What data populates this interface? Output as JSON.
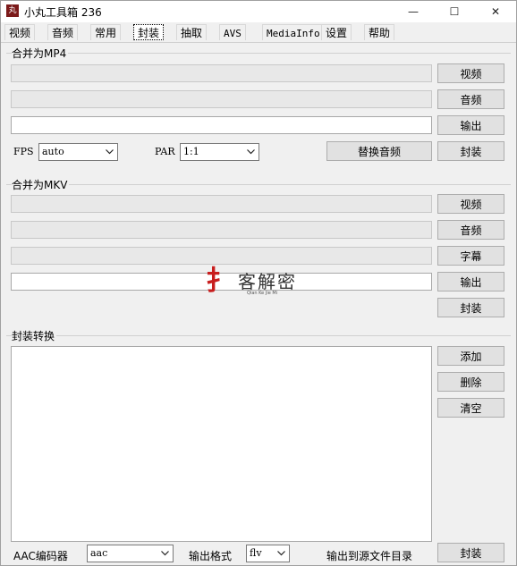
{
  "window": {
    "title": "小丸工具箱 236",
    "icon_glyph": "丸",
    "minimize_glyph": "—",
    "maximize_glyph": "☐",
    "close_glyph": "✕"
  },
  "tabs": [
    "视频",
    "音频",
    "常用",
    "封装",
    "抽取",
    "AVS",
    "MediaInfo",
    "设置",
    "帮助"
  ],
  "active_tab": "封装",
  "mp4": {
    "group_label": "合并为MP4",
    "video_button": "视频",
    "audio_button": "音频",
    "output_button": "输出",
    "fps_label": "FPS",
    "fps_value": "auto",
    "par_label": "PAR",
    "par_value": "1:1",
    "replace_audio_button": "替换音频",
    "mux_button": "封装"
  },
  "mkv": {
    "group_label": "合并为MKV",
    "video_button": "视频",
    "audio_button": "音频",
    "subtitle_button": "字幕",
    "output_button": "输出",
    "mux_button": "封装"
  },
  "convert": {
    "group_label": "封装转换",
    "add_button": "添加",
    "delete_button": "删除",
    "clear_button": "清空",
    "aac_label": "AAC编码器",
    "aac_value": "aac",
    "format_label": "输出格式",
    "format_value": "flv",
    "output_to_source_label": "输出到源文件目录",
    "mux_button": "封装"
  },
  "watermark": {
    "mark": "扌",
    "text": "客解密",
    "sub": "Qian Ke Jie Mi"
  }
}
